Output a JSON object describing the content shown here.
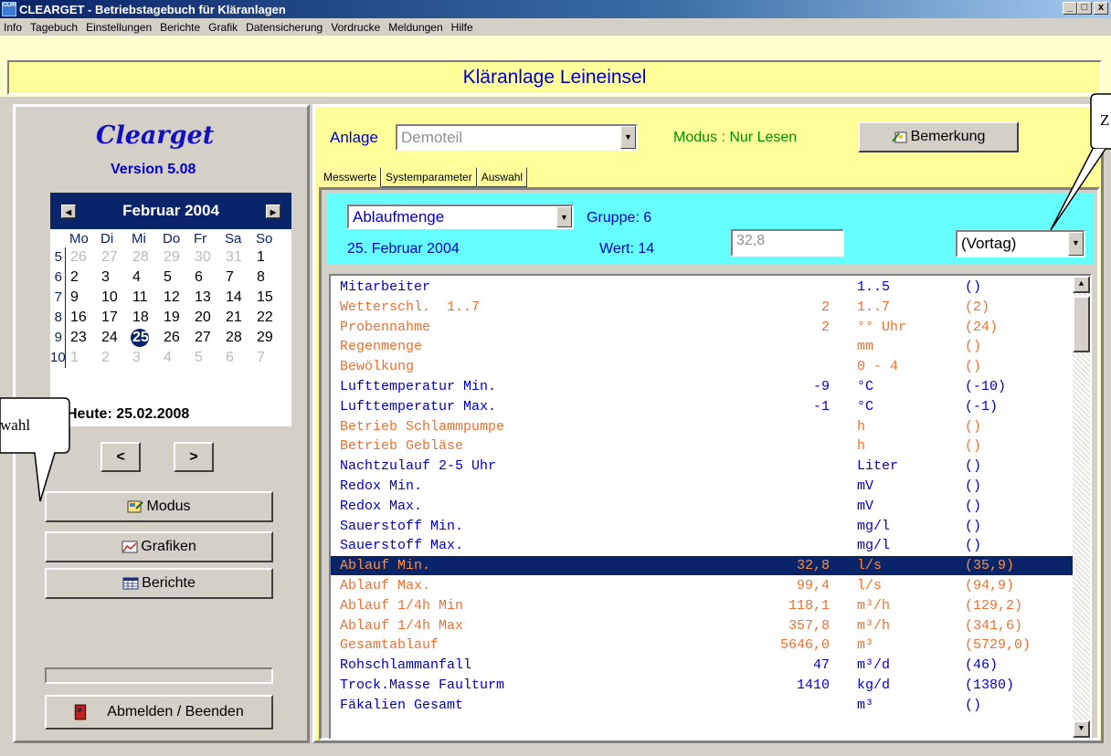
{
  "window": {
    "title": "CLEARGET - Betriebstagebuch für Kläranlagen",
    "icon_text": "CLRGET",
    "controls": [
      "_",
      "□",
      "x"
    ]
  },
  "menu": [
    "Info",
    "Tagebuch",
    "Einstellungen",
    "Berichte",
    "Grafik",
    "Datensicherung",
    "Vordrucke",
    "Meldungen",
    "Hilfe"
  ],
  "banner": "Kläranlage Leineinsel",
  "sidebar": {
    "logo": "Clearget",
    "version": "Version 5.08",
    "calendar": {
      "month": "Februar 2004",
      "weekdays": [
        "Mo",
        "Di",
        "Mi",
        "Do",
        "Fr",
        "Sa",
        "So"
      ],
      "weeks": [
        {
          "wk": "5",
          "days": [
            [
              "26",
              1
            ],
            [
              "27",
              1
            ],
            [
              "28",
              1
            ],
            [
              "29",
              1
            ],
            [
              "30",
              1
            ],
            [
              "31",
              1
            ],
            [
              "1",
              0
            ]
          ]
        },
        {
          "wk": "6",
          "days": [
            [
              "2",
              0
            ],
            [
              "3",
              0
            ],
            [
              "4",
              0
            ],
            [
              "5",
              0
            ],
            [
              "6",
              0
            ],
            [
              "7",
              0
            ],
            [
              "8",
              0
            ]
          ]
        },
        {
          "wk": "7",
          "days": [
            [
              "9",
              0
            ],
            [
              "10",
              0
            ],
            [
              "11",
              0
            ],
            [
              "12",
              0
            ],
            [
              "13",
              0
            ],
            [
              "14",
              0
            ],
            [
              "15",
              0
            ]
          ]
        },
        {
          "wk": "8",
          "days": [
            [
              "16",
              0
            ],
            [
              "17",
              0
            ],
            [
              "18",
              0
            ],
            [
              "19",
              0
            ],
            [
              "20",
              0
            ],
            [
              "21",
              0
            ],
            [
              "22",
              0
            ]
          ]
        },
        {
          "wk": "9",
          "days": [
            [
              "23",
              0
            ],
            [
              "24",
              0
            ],
            [
              "25",
              2
            ],
            [
              "26",
              0
            ],
            [
              "27",
              0
            ],
            [
              "28",
              0
            ],
            [
              "29",
              0
            ]
          ]
        },
        {
          "wk": "10",
          "days": [
            [
              "1",
              1
            ],
            [
              "2",
              1
            ],
            [
              "3",
              1
            ],
            [
              "4",
              1
            ],
            [
              "5",
              1
            ],
            [
              "6",
              1
            ],
            [
              "7",
              1
            ]
          ]
        }
      ],
      "today": "Heute: 25.02.2008"
    },
    "prev_label": "<",
    "next_label": ">",
    "modus_label": "Modus",
    "grafiken_label": "Grafiken",
    "berichte_label": "Berichte",
    "exit_label": "Abmelden / Beenden"
  },
  "main": {
    "anlage_label": "Anlage",
    "anlage_value": "Demoteil",
    "modus_text": "Modus : Nur Lesen",
    "bemerkung_label": "Bemerkung",
    "tabs": [
      "Messwerte",
      "Systemparameter",
      "Auswahl"
    ],
    "parameter": "Ablaufmenge",
    "gruppe": "Gruppe: 6",
    "datum": "25. Februar 2004",
    "wert_label": "Wert: 14",
    "wert_value": "32,8",
    "compare_option": "(Vortag)",
    "rows": [
      {
        "name": "Mitarbeiter",
        "value": "",
        "unit": "1..5",
        "prev": "()",
        "color": "blue"
      },
      {
        "name": "Wetterschl.  1..7",
        "value": "2",
        "unit": "1..7",
        "prev": "(2)",
        "color": "orange"
      },
      {
        "name": "Probennahme",
        "value": "2",
        "unit": "°° Uhr",
        "prev": "(24)",
        "color": "orange"
      },
      {
        "name": "Regenmenge",
        "value": "",
        "unit": "mm",
        "prev": "()",
        "color": "orange"
      },
      {
        "name": "Bewölkung",
        "value": "",
        "unit": "0 - 4",
        "prev": "()",
        "color": "orange"
      },
      {
        "name": "Lufttemperatur Min.",
        "value": "-9",
        "unit": "°C",
        "prev": "(-10)",
        "color": "blue"
      },
      {
        "name": "Lufttemperatur Max.",
        "value": "-1",
        "unit": "°C",
        "prev": "(-1)",
        "color": "blue"
      },
      {
        "name": "Betrieb Schlammpumpe",
        "value": "",
        "unit": "h",
        "prev": "()",
        "color": "orange"
      },
      {
        "name": "Betrieb Gebläse",
        "value": "",
        "unit": "h",
        "prev": "()",
        "color": "orange"
      },
      {
        "name": "Nachtzulauf 2-5 Uhr",
        "value": "",
        "unit": "Liter",
        "prev": "()",
        "color": "blue"
      },
      {
        "name": "Redox Min.",
        "value": "",
        "unit": "mV",
        "prev": "()",
        "color": "blue"
      },
      {
        "name": "Redox Max.",
        "value": "",
        "unit": "mV",
        "prev": "()",
        "color": "blue"
      },
      {
        "name": "Sauerstoff Min.",
        "value": "",
        "unit": "mg/l",
        "prev": "()",
        "color": "blue"
      },
      {
        "name": "Sauerstoff Max.",
        "value": "",
        "unit": "mg/l",
        "prev": "()",
        "color": "blue"
      },
      {
        "name": "Ablauf Min.",
        "value": "32,8",
        "unit": "l/s",
        "prev": "(35,9)",
        "color": "sel"
      },
      {
        "name": "Ablauf Max.",
        "value": "99,4",
        "unit": "l/s",
        "prev": "(94,9)",
        "color": "orange"
      },
      {
        "name": "Ablauf 1/4h Min",
        "value": "118,1",
        "unit": "m³/h",
        "prev": "(129,2)",
        "color": "orange"
      },
      {
        "name": "Ablauf 1/4h Max",
        "value": "357,8",
        "unit": "m³/h",
        "prev": "(341,6)",
        "color": "orange"
      },
      {
        "name": "Gesamtablauf",
        "value": "5646,0",
        "unit": "m³",
        "prev": "(5729,0)",
        "color": "orange"
      },
      {
        "name": "Rohschlammanfall",
        "value": "47",
        "unit": "m³/d",
        "prev": "(46)",
        "color": "blue"
      },
      {
        "name": "Trock.Masse Faulturm",
        "value": "1410",
        "unit": "kg/d",
        "prev": "(1380)",
        "color": "blue"
      },
      {
        "name": "Fäkalien Gesamt",
        "value": "",
        "unit": "m³",
        "prev": "()",
        "color": "blue"
      }
    ]
  },
  "callouts": {
    "left_text": "wahl",
    "right_text": "Z"
  }
}
